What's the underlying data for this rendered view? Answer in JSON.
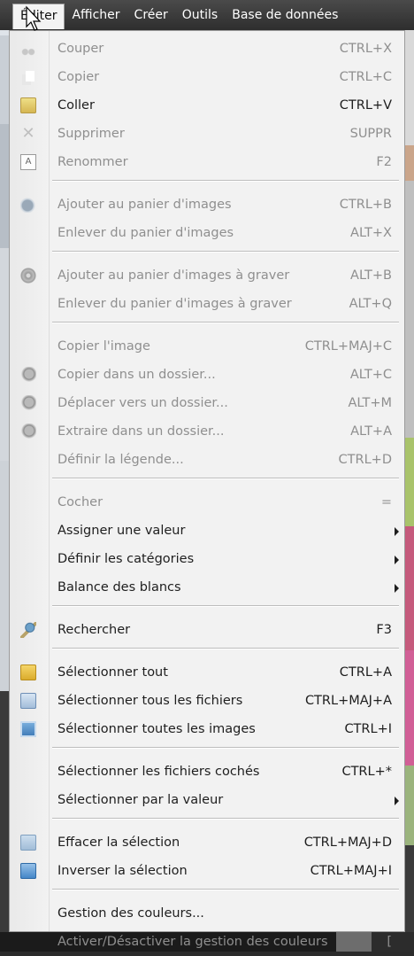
{
  "menubar": {
    "items": [
      "Éditer",
      "Afficher",
      "Créer",
      "Outils",
      "Base de données"
    ]
  },
  "menu": {
    "rows": [
      {
        "label": "Couper",
        "shortcut": "CTRL+X",
        "disabled": true,
        "icon": "scissors-icon"
      },
      {
        "label": "Copier",
        "shortcut": "CTRL+C",
        "disabled": true,
        "icon": "copy-icon"
      },
      {
        "label": "Coller",
        "shortcut": "CTRL+V",
        "disabled": false,
        "icon": "paste-icon"
      },
      {
        "label": "Supprimer",
        "shortcut": "SUPPR",
        "disabled": true,
        "icon": "delete-icon"
      },
      {
        "label": "Renommer",
        "shortcut": "F2",
        "disabled": true,
        "icon": "rename-icon"
      },
      {
        "label": "Ajouter au panier d'images",
        "shortcut": "CTRL+B",
        "disabled": true,
        "icon": "basket-add-icon"
      },
      {
        "label": "Enlever du panier d'images",
        "shortcut": "ALT+X",
        "disabled": true,
        "icon": ""
      },
      {
        "label": "Ajouter au panier d'images à graver",
        "shortcut": "ALT+B",
        "disabled": true,
        "icon": "burn-disc-icon"
      },
      {
        "label": "Enlever du panier d'images à graver",
        "shortcut": "ALT+Q",
        "disabled": true,
        "icon": ""
      },
      {
        "label": "Copier l'image",
        "shortcut": "CTRL+MAJ+C",
        "disabled": true,
        "icon": ""
      },
      {
        "label": "Copier dans un dossier...",
        "shortcut": "ALT+C",
        "disabled": true,
        "icon": "copy-to-folder-icon"
      },
      {
        "label": "Déplacer vers un dossier...",
        "shortcut": "ALT+M",
        "disabled": true,
        "icon": "move-to-folder-icon"
      },
      {
        "label": "Extraire dans un dossier...",
        "shortcut": "ALT+A",
        "disabled": true,
        "icon": "extract-icon"
      },
      {
        "label": "Définir la légende...",
        "shortcut": "CTRL+D",
        "disabled": true,
        "icon": ""
      },
      {
        "label": "Cocher",
        "shortcut": "=",
        "disabled": true,
        "icon": ""
      },
      {
        "label": "Assigner une valeur",
        "shortcut": "",
        "disabled": false,
        "icon": "",
        "submenu": true
      },
      {
        "label": "Définir les catégories",
        "shortcut": "",
        "disabled": false,
        "icon": "",
        "submenu": true
      },
      {
        "label": "Balance des blancs",
        "shortcut": "",
        "disabled": false,
        "icon": "",
        "submenu": true
      },
      {
        "label": "Rechercher",
        "shortcut": "F3",
        "disabled": false,
        "icon": "search-icon"
      },
      {
        "label": "Sélectionner tout",
        "shortcut": "CTRL+A",
        "disabled": false,
        "icon": "folder-icon"
      },
      {
        "label": "Sélectionner tous les fichiers",
        "shortcut": "CTRL+MAJ+A",
        "disabled": false,
        "icon": "file-icon"
      },
      {
        "label": "Sélectionner toutes les images",
        "shortcut": "CTRL+I",
        "disabled": false,
        "icon": "image-icon"
      },
      {
        "label": "Sélectionner les fichiers cochés",
        "shortcut": "CTRL+*",
        "disabled": false,
        "icon": ""
      },
      {
        "label": "Sélectionner par la valeur",
        "shortcut": "",
        "disabled": false,
        "icon": "",
        "submenu": true
      },
      {
        "label": "Effacer la sélection",
        "shortcut": "CTRL+MAJ+D",
        "disabled": false,
        "icon": "clear-selection-icon"
      },
      {
        "label": "Inverser la sélection",
        "shortcut": "CTRL+MAJ+I",
        "disabled": false,
        "icon": "invert-selection-icon"
      },
      {
        "label": "Gestion des couleurs...",
        "shortcut": "",
        "disabled": false,
        "icon": ""
      },
      {
        "label": "Activer/Désactiver la gestion des couleurs",
        "shortcut": "[",
        "disabled": true,
        "icon": ""
      }
    ]
  }
}
